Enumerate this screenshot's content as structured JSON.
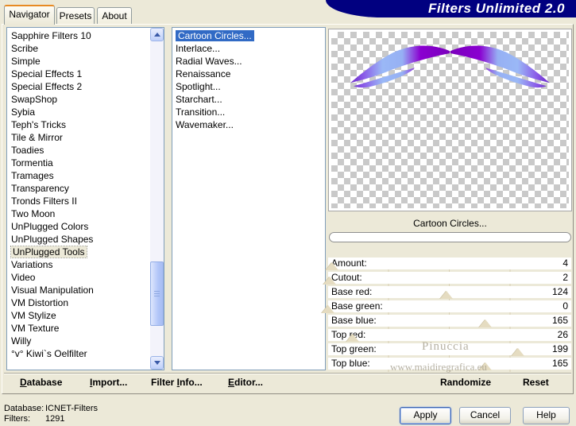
{
  "window": {
    "banner_title": "Filters Unlimited 2.0",
    "banner_color": "#010080",
    "dialog_bg": "#ece9d8",
    "selection_color": "#316ac5"
  },
  "tabs": [
    {
      "label": "Navigator",
      "active": true
    },
    {
      "label": "Presets",
      "active": false
    },
    {
      "label": "About",
      "active": false
    }
  ],
  "category_list": {
    "items": [
      "Sapphire Filters 10",
      "Scribe",
      "Simple",
      "Special Effects 1",
      "Special Effects 2",
      "SwapShop",
      "Sybia",
      "Teph's Tricks",
      "Tile & Mirror",
      "Toadies",
      "Tormentia",
      "Tramages",
      "Transparency",
      "Tronds Filters II",
      "Two Moon",
      "UnPlugged Colors",
      "UnPlugged Shapes",
      "UnPlugged Tools",
      "Variations",
      "Video",
      "Visual Manipulation",
      "VM Distortion",
      "VM Stylize",
      "VM Texture",
      "Willy",
      "°v° Kiwi`s Oelfilter"
    ],
    "selected": "UnPlugged Tools"
  },
  "filter_list": {
    "items": [
      "Cartoon Circles...",
      "Interlace...",
      "Radial Waves...",
      "Renaissance",
      "Spotlight...",
      "Starchart...",
      "Transition...",
      "Wavemaker..."
    ],
    "selected": "Cartoon Circles..."
  },
  "preview": {
    "caption": "Cartoon Circles...",
    "progress_value": 0,
    "watermark_line1": "Pinuccia",
    "watermark_line2": "www.maidiregrafica.eu"
  },
  "parameters": [
    {
      "label": "Amount:",
      "value": 4,
      "max": 255
    },
    {
      "label": "Cutout:",
      "value": 2,
      "max": 255
    },
    {
      "label": "Base red:",
      "value": 124,
      "max": 255
    },
    {
      "label": "Base green:",
      "value": 0,
      "max": 255
    },
    {
      "label": "Base blue:",
      "value": 165,
      "max": 255
    },
    {
      "label": "Top red:",
      "value": 26,
      "max": 255
    },
    {
      "label": "Top green:",
      "value": 199,
      "max": 255
    },
    {
      "label": "Top blue:",
      "value": 165,
      "max": 255
    }
  ],
  "commands": {
    "database": {
      "label": "Database",
      "underline": 0
    },
    "import": {
      "label": "Import...",
      "underline": 0
    },
    "filter_info": {
      "label": "Filter Info...",
      "underline": 7
    },
    "editor": {
      "label": "Editor...",
      "underline": 0
    },
    "randomize": {
      "label": "Randomize",
      "underline": -1
    },
    "reset": {
      "label": "Reset",
      "underline": -1
    }
  },
  "status": {
    "database_label": "Database:",
    "database_value": "ICNET-Filters",
    "filters_label": "Filters:",
    "filters_value": "1291"
  },
  "action_buttons": {
    "apply": "Apply",
    "cancel": "Cancel",
    "help": "Help"
  },
  "icons": {
    "scroll_up": "chevron-up-icon",
    "scroll_down": "chevron-down-icon"
  }
}
